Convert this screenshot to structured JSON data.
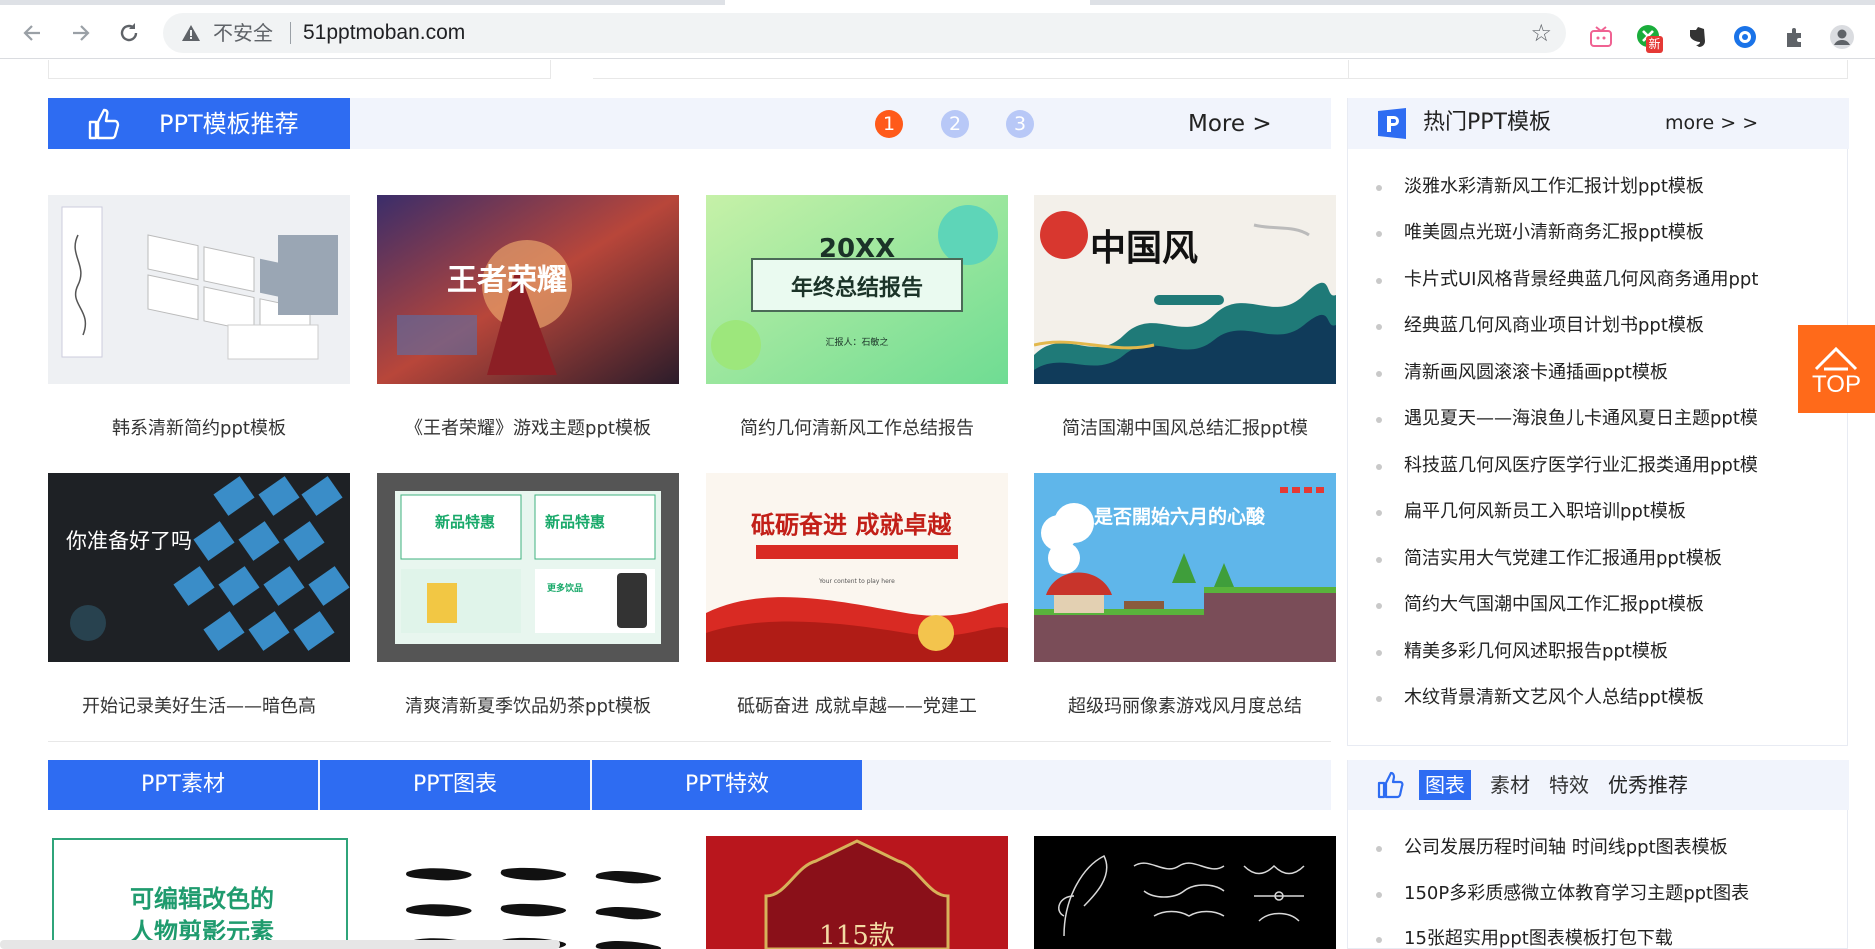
{
  "browser": {
    "security_label": "不安全",
    "url": "51pptmoban.com",
    "ext_badge": "新"
  },
  "recommend": {
    "title": "PPT模板推荐",
    "pages": [
      "1",
      "2",
      "3"
    ],
    "active_page": "1",
    "more_label": "More >",
    "items": [
      {
        "caption": "韩系清新简约ppt模板"
      },
      {
        "caption": "《王者荣耀》游戏主题ppt模板",
        "image_text": "王者荣耀"
      },
      {
        "caption": "简约几何清新风工作总结报告",
        "image_text": "20XX",
        "image_text2": "年终总结报告",
        "image_text3": "汇报人：石敏之"
      },
      {
        "caption": "简洁国潮中国风总结汇报ppt模",
        "image_text": "中国风"
      },
      {
        "caption": "开始记录美好生活——暗色高",
        "image_text": "你准备好了吗"
      },
      {
        "caption": "清爽清新夏季饮品奶茶ppt模板",
        "image_text": "新品特惠",
        "image_text2": "新品特惠",
        "image_text3": "更多饮品"
      },
      {
        "caption": "砥砺奋进 成就卓越——党建工",
        "image_text": "砥砺奋进  成就卓越"
      },
      {
        "caption": "超级玛丽像素游戏风月度总结",
        "image_text": "是否開始六月的心酸"
      }
    ]
  },
  "hot": {
    "title": "热门PPT模板",
    "more_label": "more > >",
    "items": [
      "淡雅水彩清新风工作汇报计划ppt模板",
      "唯美圆点光斑小清新商务汇报ppt模板",
      "卡片式UI风格背景经典蓝几何风商务通用ppt",
      "经典蓝几何风商业项目计划书ppt模板",
      "清新画风圆滚滚卡通插画ppt模板",
      "遇见夏天——海浪鱼儿卡通风夏日主题ppt模",
      "科技蓝几何风医疗医学行业汇报类通用ppt模",
      "扁平几何风新员工入职培训ppt模板",
      "简洁实用大气党建工作汇报通用ppt模板",
      "简约大气国潮中国风工作汇报ppt模板",
      "精美多彩几何风述职报告ppt模板",
      "木纹背景清新文艺风个人总结ppt模板"
    ]
  },
  "top_button": {
    "label": "TOP"
  },
  "tabs": [
    "PPT素材",
    "PPT图表",
    "PPT特效"
  ],
  "side2": {
    "chips": [
      "图表",
      "素材",
      "特效",
      "优秀推荐"
    ],
    "active_chip": "图表",
    "items": [
      "公司发展历程时间轴 时间线ppt图表模板",
      "150P多彩质感微立体教育学习主题ppt图表",
      "15张超实用ppt图表模板打包下载"
    ]
  },
  "bottom_cards": [
    {
      "image_text": "可编辑改色的",
      "image_text2": "人物剪影元素"
    },
    {
      "image_text": ""
    },
    {
      "image_text": "115款"
    },
    {
      "image_text": ""
    }
  ],
  "colors": {
    "brand_blue": "#2e6cf2",
    "pager_active": "#ff5a1a",
    "top_orange": "#ff6a1a",
    "panel_bg": "#f1f4fc"
  }
}
